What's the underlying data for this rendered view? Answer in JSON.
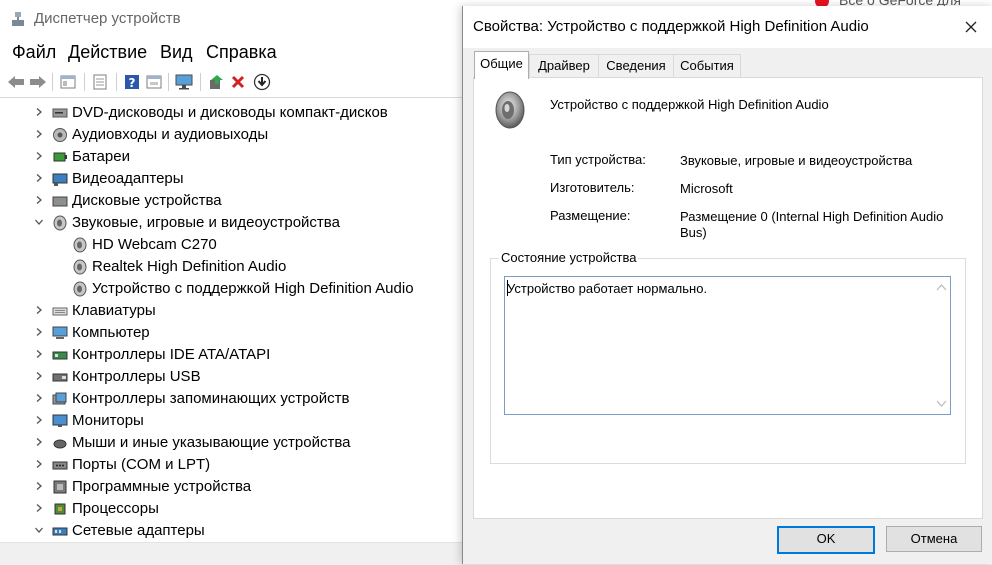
{
  "main_window": {
    "title": "Диспетчер устройств",
    "background_tab_text": "Всё о GeForce для",
    "menu": [
      "Файл",
      "Действие",
      "Вид",
      "Справка"
    ],
    "toolbar_icons": [
      "back-arrow-icon",
      "forward-arrow-icon",
      "properties-icon",
      "refresh-icon",
      "help-icon",
      "show-hidden-icon",
      "monitor-scan-icon",
      "update-driver-icon",
      "uninstall-icon",
      "download-icon"
    ]
  },
  "tree": [
    {
      "label": "DVD-дисководы и дисководы компакт-дисков",
      "icon": "dvd-drive-icon",
      "level": 0,
      "expanded": false
    },
    {
      "label": "Аудиовходы и аудиовыходы",
      "icon": "audio-io-icon",
      "level": 0,
      "expanded": false
    },
    {
      "label": "Батареи",
      "icon": "battery-icon",
      "level": 0,
      "expanded": false
    },
    {
      "label": "Видеоадаптеры",
      "icon": "display-adapter-icon",
      "level": 0,
      "expanded": false
    },
    {
      "label": "Дисковые устройства",
      "icon": "disk-drive-icon",
      "level": 0,
      "expanded": false
    },
    {
      "label": "Звуковые, игровые и видеоустройства",
      "icon": "speaker-icon",
      "level": 0,
      "expanded": true
    },
    {
      "label": "HD Webcam C270",
      "icon": "speaker-icon",
      "level": 1
    },
    {
      "label": "Realtek High Definition Audio",
      "icon": "speaker-icon",
      "level": 1
    },
    {
      "label": "Устройство с поддержкой High Definition Audio",
      "icon": "speaker-icon",
      "level": 1
    },
    {
      "label": "Клавиатуры",
      "icon": "keyboard-icon",
      "level": 0,
      "expanded": false
    },
    {
      "label": "Компьютер",
      "icon": "computer-icon",
      "level": 0,
      "expanded": false
    },
    {
      "label": "Контроллеры IDE ATA/ATAPI",
      "icon": "ide-controller-icon",
      "level": 0,
      "expanded": false
    },
    {
      "label": "Контроллеры USB",
      "icon": "usb-icon",
      "level": 0,
      "expanded": false
    },
    {
      "label": "Контроллеры запоминающих устройств",
      "icon": "storage-controller-icon",
      "level": 0,
      "expanded": false
    },
    {
      "label": "Мониторы",
      "icon": "monitor-icon",
      "level": 0,
      "expanded": false
    },
    {
      "label": "Мыши и иные указывающие устройства",
      "icon": "mouse-icon",
      "level": 0,
      "expanded": false
    },
    {
      "label": "Порты (COM и LPT)",
      "icon": "port-icon",
      "level": 0,
      "expanded": false
    },
    {
      "label": "Программные устройства",
      "icon": "software-device-icon",
      "level": 0,
      "expanded": false
    },
    {
      "label": "Процессоры",
      "icon": "processor-icon",
      "level": 0,
      "expanded": false
    },
    {
      "label": "Сетевые адаптеры",
      "icon": "network-adapter-icon",
      "level": 0,
      "expanded": true
    }
  ],
  "dialog": {
    "title": "Свойства: Устройство с поддержкой High Definition Audio",
    "tabs": [
      "Общие",
      "Драйвер",
      "Сведения",
      "События"
    ],
    "active_tab": "Общие",
    "device_name": "Устройство с поддержкой High Definition Audio",
    "device_type_label": "Тип устройства:",
    "device_type_value": "Звуковые, игровые и видеоустройства",
    "manufacturer_label": "Изготовитель:",
    "manufacturer_value": "Microsoft",
    "location_label": "Размещение:",
    "location_value_line1": "Размещение 0 (Internal High Definition Audio",
    "location_value_line2": "Bus)",
    "status_group_label": "Состояние устройства",
    "status_text": "Устройство работает нормально.",
    "ok_label": "OK",
    "cancel_label": "Отмена"
  },
  "colors": {
    "accent": "#0078d7",
    "close_red": "#e81123",
    "status_border": "#7a9cc6"
  }
}
